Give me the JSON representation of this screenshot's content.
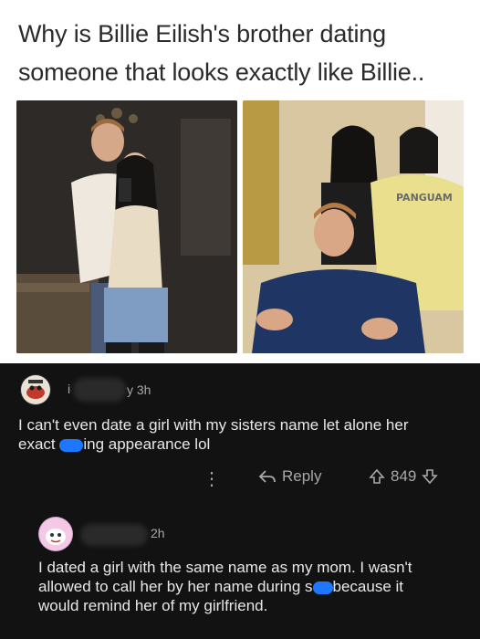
{
  "meme": {
    "caption_line1": "Why is Billie Eilish's brother dating",
    "caption_line2": "someone that looks exactly like Billie..",
    "photo_left_alt": "",
    "photo_right_alt": ""
  },
  "comments": [
    {
      "username": "",
      "time_suffix": "y 3h",
      "text_line1": "I can't even date a girl with my sisters name let alone her",
      "text_line2_pre": "exact ",
      "text_line2_post": "ing appearance lol",
      "more_label": "⋮",
      "reply_label": "Reply",
      "score": "849"
    },
    {
      "username": "",
      "time": "2h",
      "text_line1": "I dated a girl with the same name as my mom. I wasn't",
      "text_line2_pre": "allowed to call her by her name during s",
      "text_line2_post": "because it",
      "text_line3": "would remind her of my girlfriend."
    }
  ],
  "colors": {
    "background_dark": "#121212",
    "text_light": "#e8e8e8",
    "meta_gray": "#a8a8a8",
    "scribble_blue": "#1e78ff"
  },
  "icons": [
    "reddit-avatar-icon",
    "reply-arrow-icon",
    "upvote-icon",
    "downvote-icon",
    "more-options-icon"
  ]
}
